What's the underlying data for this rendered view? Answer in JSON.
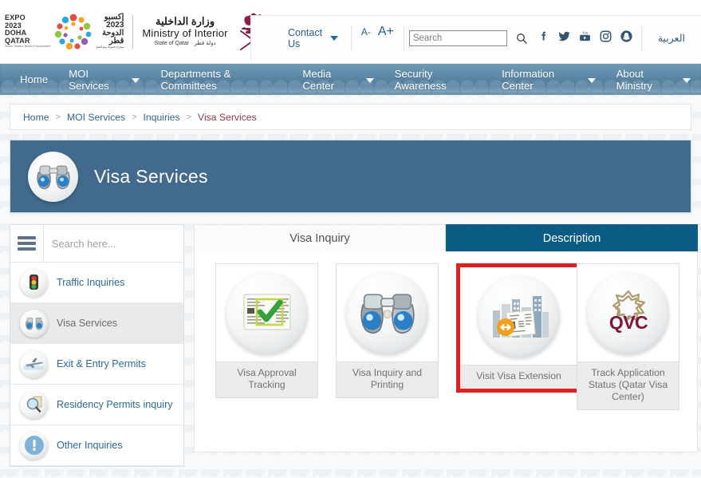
{
  "header": {
    "expo_logo": {
      "line1": "EXPO",
      "line2": "2023",
      "line3": "DOHA",
      "line4": "QATAR",
      "tagline": "Green Desert, Better Environment",
      "ar_line1": "إكسبو",
      "ar_line2": "2023",
      "ar_line3": "الدوحة",
      "ar_line4": "قطر",
      "ar_tagline": "صحراء خضراء، بيئة أفضل"
    },
    "ministry": {
      "name_ar": "وزارة الداخلية",
      "name_en": "Ministry of Interior",
      "state_en": "State of Qatar",
      "state_ar": "دولة قطر"
    },
    "contact_us": "Contact Us",
    "font_decrease": "A-",
    "font_increase": "A+",
    "search_placeholder": "Search",
    "search_value": "",
    "language_switch": "العربية",
    "socials": [
      "facebook-icon",
      "twitter-icon",
      "youtube-icon",
      "instagram-icon",
      "snapchat-icon"
    ]
  },
  "nav": {
    "items": [
      {
        "label": "Home",
        "has_dropdown": false
      },
      {
        "label": "MOI Services",
        "has_dropdown": true
      },
      {
        "label": "Departments & Committees",
        "has_dropdown": false
      },
      {
        "label": "Media Center",
        "has_dropdown": true
      },
      {
        "label": "Security Awareness",
        "has_dropdown": false
      },
      {
        "label": "Information Center",
        "has_dropdown": true
      },
      {
        "label": "About Ministry",
        "has_dropdown": true
      }
    ]
  },
  "breadcrumb": {
    "items": [
      "Home",
      "MOI Services",
      "Inquiries"
    ],
    "current": "Visa Services",
    "separator": ">"
  },
  "banner": {
    "title": "Visa Services",
    "icon": "binoculars-icon",
    "bg_color": "#416a8c"
  },
  "sidebar": {
    "search_placeholder": "Search here...",
    "search_value": "",
    "items": [
      {
        "label": "Traffic Inquiries",
        "icon": "traffic-light-icon",
        "active": false
      },
      {
        "label": "Visa Services",
        "icon": "binoculars-icon",
        "active": true
      },
      {
        "label": "Exit & Entry Permits",
        "icon": "airplane-icon",
        "active": false
      },
      {
        "label": "Residency Permits inquiry",
        "icon": "magnifier-document-icon",
        "active": false
      },
      {
        "label": "Other Inquiries",
        "icon": "exclamation-icon",
        "active": false
      }
    ]
  },
  "tabs": [
    {
      "label": "Visa Inquiry",
      "active": false
    },
    {
      "label": "Description",
      "active": true
    }
  ],
  "services": [
    {
      "label": "Visa Approval Tracking",
      "icon": "document-check-icon",
      "selected": false
    },
    {
      "label": "Visa Inquiry and Printing",
      "icon": "binoculars-icon",
      "selected": false
    },
    {
      "label": "Visit Visa Extension",
      "icon": "city-document-extend-icon",
      "selected": true
    },
    {
      "label": "Track Application Status (Qatar Visa Center)",
      "icon": "qvc-logo-icon",
      "selected": false
    }
  ],
  "colors": {
    "accent_blue": "#0b5c84",
    "banner_blue": "#416a8c",
    "selection_red": "#e02020",
    "link_blue": "#2d6a92",
    "breadcrumb_current": "#8b3a4a"
  }
}
